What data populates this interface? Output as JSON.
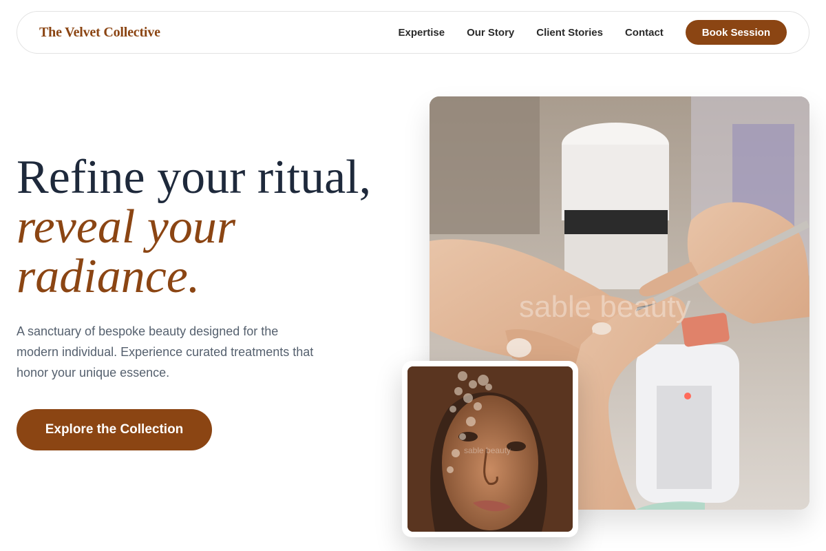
{
  "brand": {
    "name": "The Velvet Collective"
  },
  "nav": {
    "links": [
      "Expertise",
      "Our Story",
      "Client Stories",
      "Contact"
    ],
    "cta_label": "Book Session"
  },
  "hero": {
    "headline_line1": "Refine your ritual,",
    "headline_line2": "reveal your",
    "headline_line3": "radiance.",
    "lede": "A sanctuary of bespoke beauty designed for the modern individual. Experience curated treatments that honor your unique essence.",
    "cta_label": "Explore the Collection"
  },
  "images": {
    "main": {
      "subject": "manicure in progress",
      "watermark": "sable beauty"
    },
    "inset": {
      "subject": "portrait with bokeh",
      "watermark": "sable beauty"
    }
  },
  "colors": {
    "accent": "#8b4513",
    "heading": "#1e293b",
    "body_text": "#55606e"
  }
}
